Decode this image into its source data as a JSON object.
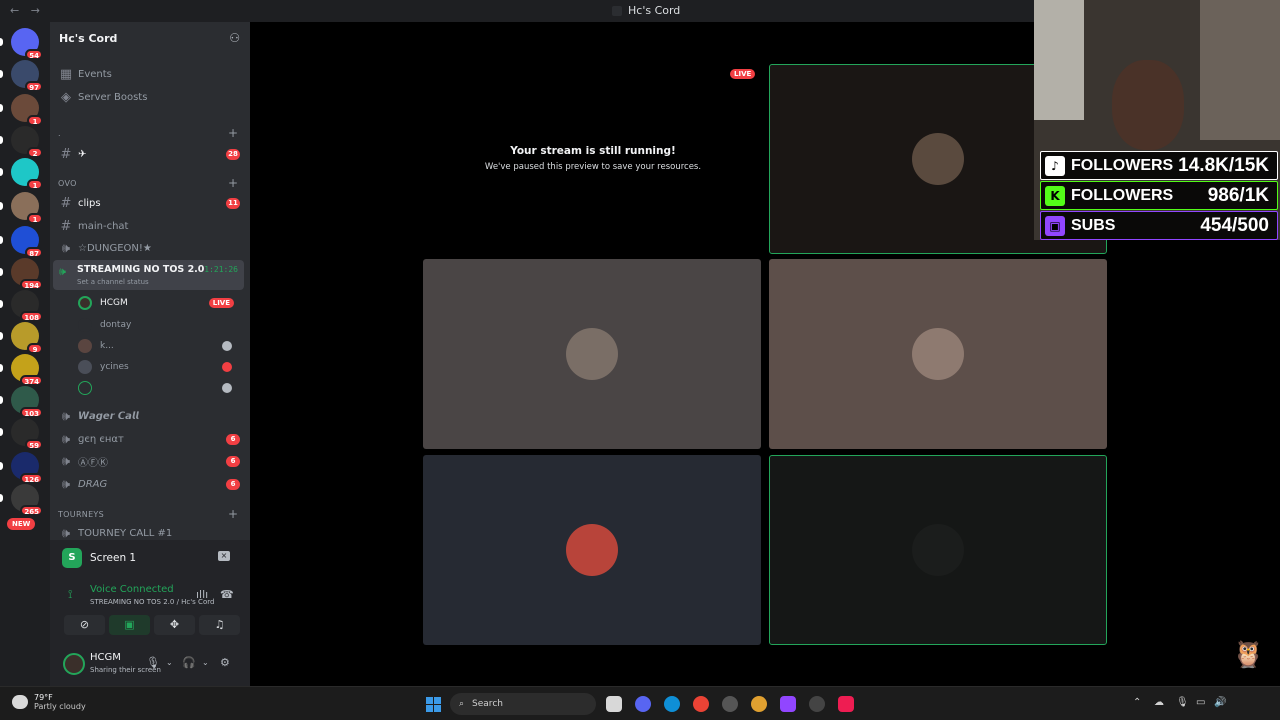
{
  "window": {
    "title": "Hc's Cord",
    "nav": "← →"
  },
  "servers": {
    "items": [
      {
        "badge": "54",
        "color": "#5865f2"
      },
      {
        "badge": "97",
        "color": "#3a4a6b"
      },
      {
        "badge": "1",
        "color": "#6b4a3a"
      },
      {
        "badge": "2",
        "color": "#2a2a2a"
      },
      {
        "badge": "1",
        "color": "#1ec7c7"
      },
      {
        "badge": "1",
        "color": "#8a6f5a"
      },
      {
        "badge": "87",
        "color": "#1f4fd6"
      },
      {
        "badge": "194",
        "color": "#5a3a2a"
      },
      {
        "badge": "108",
        "color": "#2a2a2a"
      },
      {
        "badge": "9",
        "color": "#b89b2a"
      },
      {
        "badge": "374",
        "color": "#c4a21a"
      },
      {
        "badge": "103",
        "color": "#2f5a4a"
      },
      {
        "badge": "59",
        "color": "#2a2a2a"
      },
      {
        "badge": "126",
        "color": "#1a2a6b"
      },
      {
        "badge": "265",
        "color": "#3a3a3a"
      }
    ],
    "new_label": "NEW"
  },
  "guild": {
    "name": "Hc's Cord",
    "events": "Events",
    "boosts": "Server Boosts",
    "cat_dot": ".",
    "plane_channel": "✈",
    "plane_count": "28",
    "cat_ovo": "OVO",
    "clips": "clips",
    "clips_count": "11",
    "main_chat": "main-chat",
    "dungeon": "☆DUNGEON!★",
    "voice": {
      "name": "STREAMING NO TOS 2.0",
      "status": "Set a channel status",
      "timer": "1:21:26",
      "users": [
        {
          "name": "HCGM",
          "live": "LIVE"
        },
        {
          "name": "dontay"
        },
        {
          "name": "k..."
        },
        {
          "name": "ycines"
        },
        {
          "name": ""
        }
      ]
    },
    "wager": "𝙒𝙖𝙜𝙚𝙧 𝘾𝙖𝙡𝙡",
    "gen_chat": "ɡєη єнαт",
    "gen_count": "6",
    "afk": "ⒶⒻⓀ",
    "afk_count": "6",
    "drag": "DRAG",
    "drag_count": "6",
    "cat_tourneys": "TOURNEYS",
    "tourney_call": "TOURNEY CALL #1"
  },
  "screen_panel": {
    "title": "Screen 1"
  },
  "voice_panel": {
    "connected": "Voice Connected",
    "channel": "STREAMING NO TOS 2.0 / Hc's Cord"
  },
  "user_panel": {
    "name": "HCGM",
    "status": "Sharing their screen"
  },
  "stage": {
    "paused_title": "Your stream is still running!",
    "paused_sub": "We've paused this preview to save your resources.",
    "live": "LIVE"
  },
  "overlay": {
    "stats": [
      {
        "label": "FOLLOWERS",
        "value": "14.8K/15K",
        "color": "#ffffff",
        "logo": "♪"
      },
      {
        "label": "FOLLOWERS",
        "value": "986/1K",
        "color": "#53fc18",
        "logo": "K"
      },
      {
        "label": "SUBS",
        "value": "454/500",
        "color": "#9146ff",
        "logo": "▣"
      }
    ]
  },
  "taskbar": {
    "temp": "79°F",
    "weather": "Partly cloudy",
    "search": "Search"
  }
}
